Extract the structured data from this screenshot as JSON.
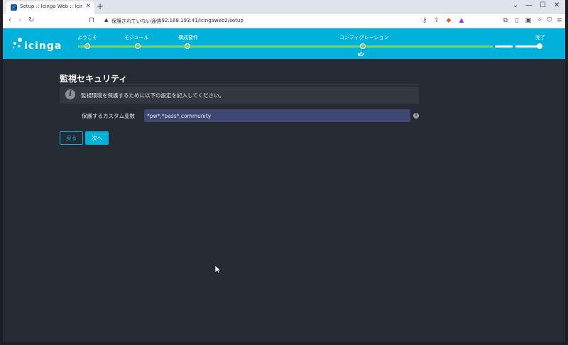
{
  "browser": {
    "tab_title": "Setup :: Icinga Web :: Icinga We",
    "tab_close": "✕",
    "new_tab": "+",
    "security_warning": "保護されていない通信",
    "url": "192.168.193.41/icingaweb2/setup",
    "window_controls": {
      "minimize": "—",
      "maximize": "☐",
      "close": "✕"
    }
  },
  "app": {
    "logo_text": "icinga",
    "accent_color": "#00b2db",
    "progress_color": "#7dd36a"
  },
  "wizard_steps": [
    {
      "label": "ようこそ",
      "state": "complete"
    },
    {
      "label": "モジュール",
      "state": "complete"
    },
    {
      "label": "構成要件",
      "state": "complete"
    },
    {
      "label": "コンフィグレーション",
      "state": "current"
    },
    {
      "label": "完了",
      "state": "pending"
    }
  ],
  "page": {
    "title": "監視セキュリティ",
    "info_text": "監視環境を保護するために以下の設定を記入してください。",
    "field_label": "保護するカスタム変数",
    "field_value": "*pw*,*pass*,community",
    "back_label": "戻る",
    "next_label": "次へ"
  }
}
